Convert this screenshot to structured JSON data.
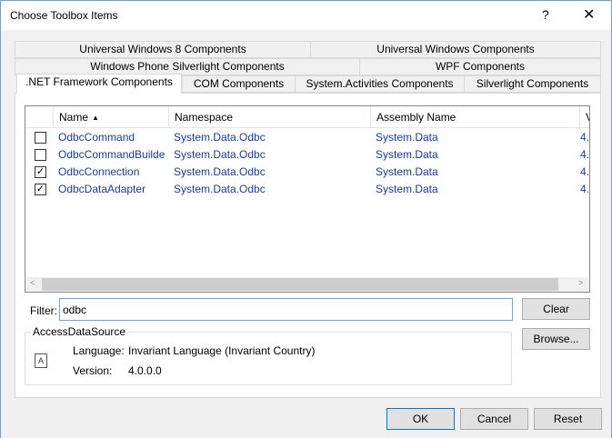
{
  "window": {
    "title": "Choose Toolbox Items",
    "help_glyph": "?",
    "close_glyph": "✕"
  },
  "tabs": {
    "row1": [
      "Universal Windows 8 Components",
      "Universal Windows Components"
    ],
    "row2": [
      "Windows Phone Silverlight Components",
      "WPF Components"
    ],
    "row3": [
      ".NET Framework Components",
      "COM Components",
      "System.Activities Components",
      "Silverlight Components"
    ],
    "active": ".NET Framework Components"
  },
  "list": {
    "columns": [
      "Name",
      "Namespace",
      "Assembly Name",
      "Ve"
    ],
    "sort_glyph": "▲",
    "rows": [
      {
        "checked": false,
        "name": "OdbcCommand",
        "namespace": "System.Data.Odbc",
        "assembly": "System.Data",
        "version": "4."
      },
      {
        "checked": false,
        "name": "OdbcCommandBuilder",
        "namespace": "System.Data.Odbc",
        "assembly": "System.Data",
        "version": "4."
      },
      {
        "checked": true,
        "name": "OdbcConnection",
        "namespace": "System.Data.Odbc",
        "assembly": "System.Data",
        "version": "4."
      },
      {
        "checked": true,
        "name": "OdbcDataAdapter",
        "namespace": "System.Data.Odbc",
        "assembly": "System.Data",
        "version": "4."
      }
    ],
    "check_glyph": "✓",
    "scroll_left_glyph": "<",
    "scroll_right_glyph": ">"
  },
  "filter": {
    "label": "Filter:",
    "value": "odbc",
    "clear_label": "Clear",
    "browse_label": "Browse..."
  },
  "details": {
    "title": "AccessDataSource",
    "language_label": "Language:",
    "language_value": "Invariant Language (Invariant Country)",
    "version_label": "Version:",
    "version_value": "4.0.0.0",
    "icon_glyph": "A"
  },
  "buttons": {
    "ok": "OK",
    "cancel": "Cancel",
    "reset": "Reset"
  }
}
